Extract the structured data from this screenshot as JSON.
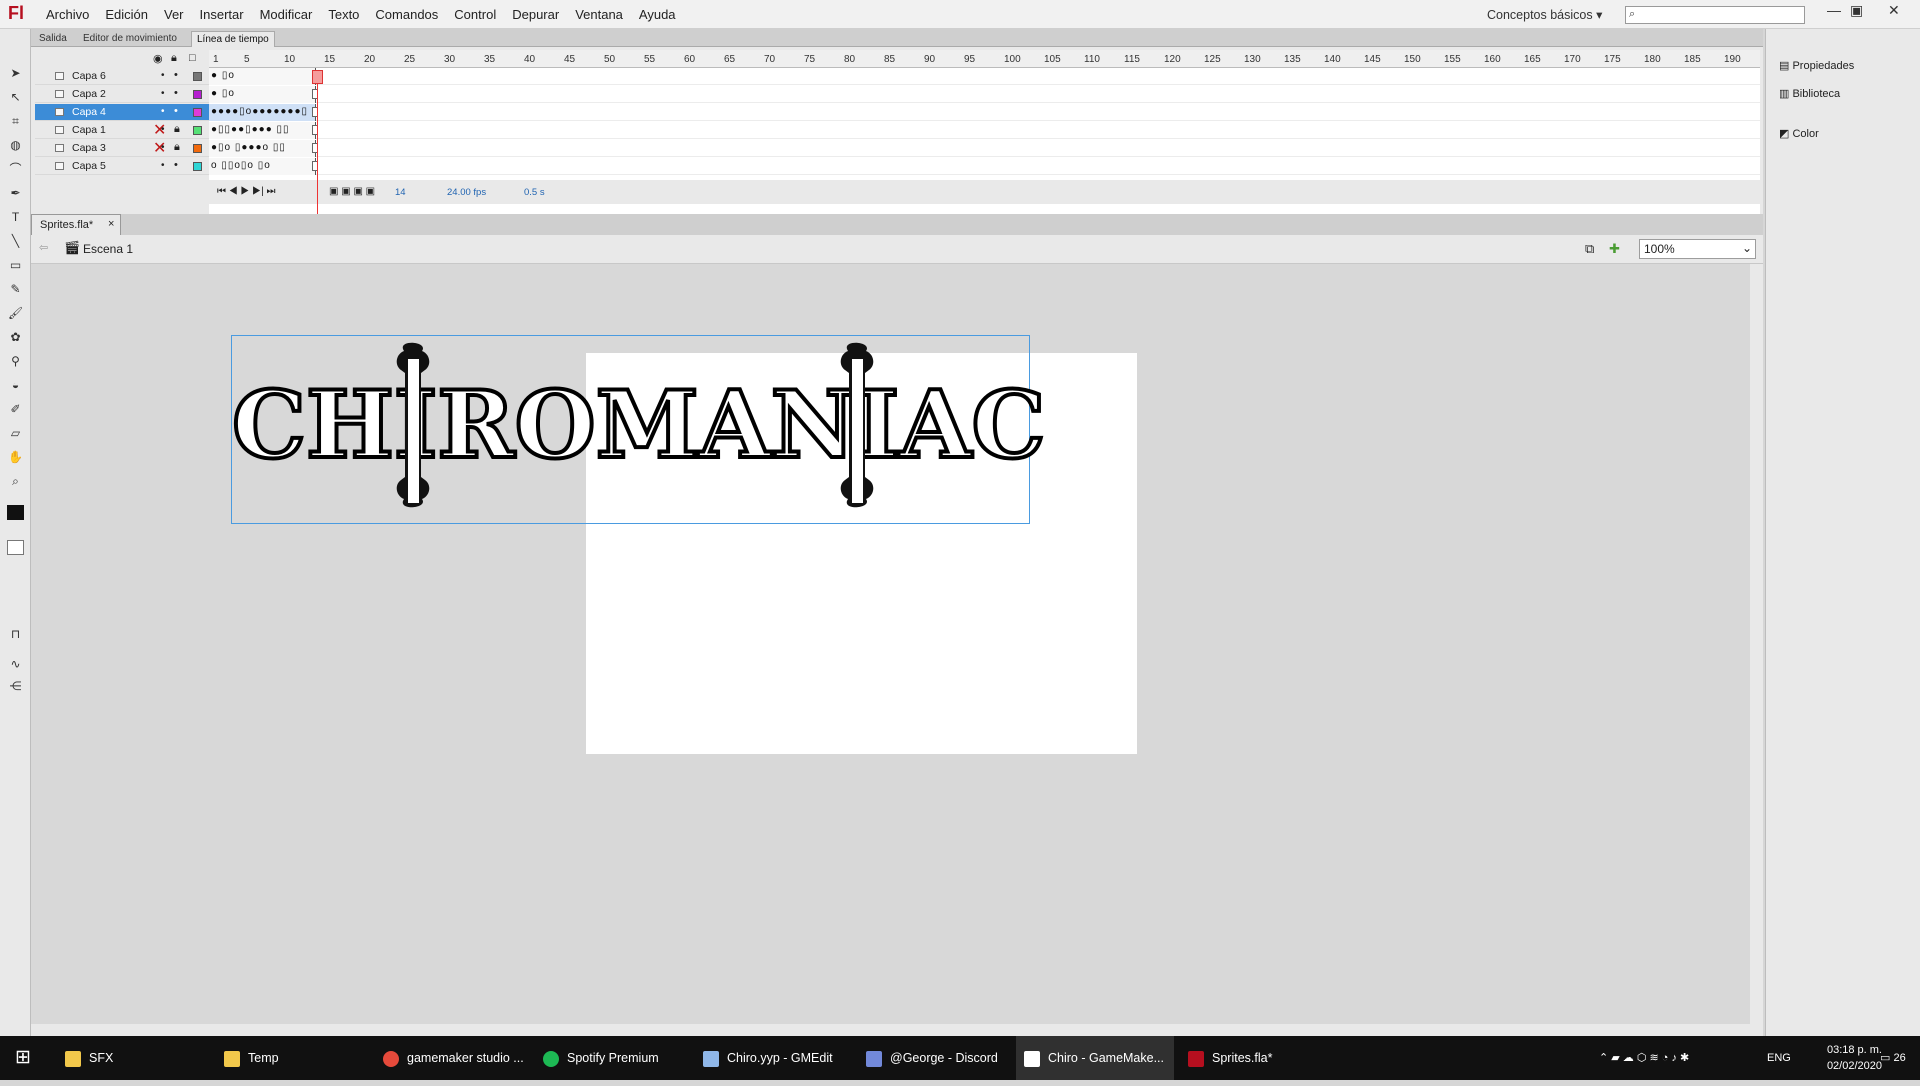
{
  "app": {
    "logo": "Fl",
    "menu": [
      "Archivo",
      "Edición",
      "Ver",
      "Insertar",
      "Modificar",
      "Texto",
      "Comandos",
      "Control",
      "Depurar",
      "Ventana",
      "Ayuda"
    ],
    "workspace": "Conceptos básicos",
    "search_icon": "search-icon"
  },
  "panel_tabs": [
    "Salida",
    "Editor de movimiento",
    "Línea de tiempo"
  ],
  "layers": [
    {
      "name": "Capa 6",
      "color": "#777777",
      "selected": false,
      "locked_x": false,
      "frames": "● ▯o"
    },
    {
      "name": "Capa 2",
      "color": "#b51fd0",
      "selected": false,
      "locked_x": false,
      "frames": "● ▯o"
    },
    {
      "name": "Capa 4",
      "color": "#e03bd8",
      "selected": true,
      "locked_x": false,
      "frames": "●●●●▯o●●●●●●●▯"
    },
    {
      "name": "Capa 1",
      "color": "#55e076",
      "selected": false,
      "locked_x": true,
      "frames": "●▯▯●●▯●●● ▯▯"
    },
    {
      "name": "Capa 3",
      "color": "#f26a0d",
      "selected": false,
      "locked_x": true,
      "frames": "●▯o ▯●●●o ▯▯"
    },
    {
      "name": "Capa 5",
      "color": "#2fd6d6",
      "selected": false,
      "locked_x": false,
      "frames": "o ▯▯o▯o ▯o"
    }
  ],
  "ruler_ticks": [
    "1",
    "5",
    "10",
    "15",
    "20",
    "25",
    "30",
    "35",
    "40",
    "45",
    "50",
    "55",
    "60",
    "65",
    "70",
    "75",
    "80",
    "85",
    "90",
    "95",
    "100",
    "105",
    "110",
    "115",
    "120",
    "125",
    "130",
    "135",
    "140",
    "145",
    "150",
    "155",
    "160",
    "165",
    "170",
    "175",
    "180",
    "185",
    "190"
  ],
  "timeline_status": {
    "frame": "14",
    "fps": "24.00 fps",
    "time": "0.5 s"
  },
  "document": {
    "tab": "Sprites.fla*",
    "scene": "Escena 1",
    "zoom": "100%"
  },
  "stage_text": "CHIROMANIAC",
  "right_panels": [
    "Propiedades",
    "Biblioteca",
    "Color"
  ],
  "taskbar": {
    "items": [
      "SFX",
      "Temp",
      "gamemaker studio ...",
      "Spotify Premium",
      "Chiro.yyp - GMEdit",
      "@George - Discord",
      "Chiro - GameMake...",
      "Sprites.fla*"
    ],
    "lang": "ENG",
    "time": "03:18 p. m.",
    "date": "02/02/2020",
    "notification_count": "26"
  }
}
